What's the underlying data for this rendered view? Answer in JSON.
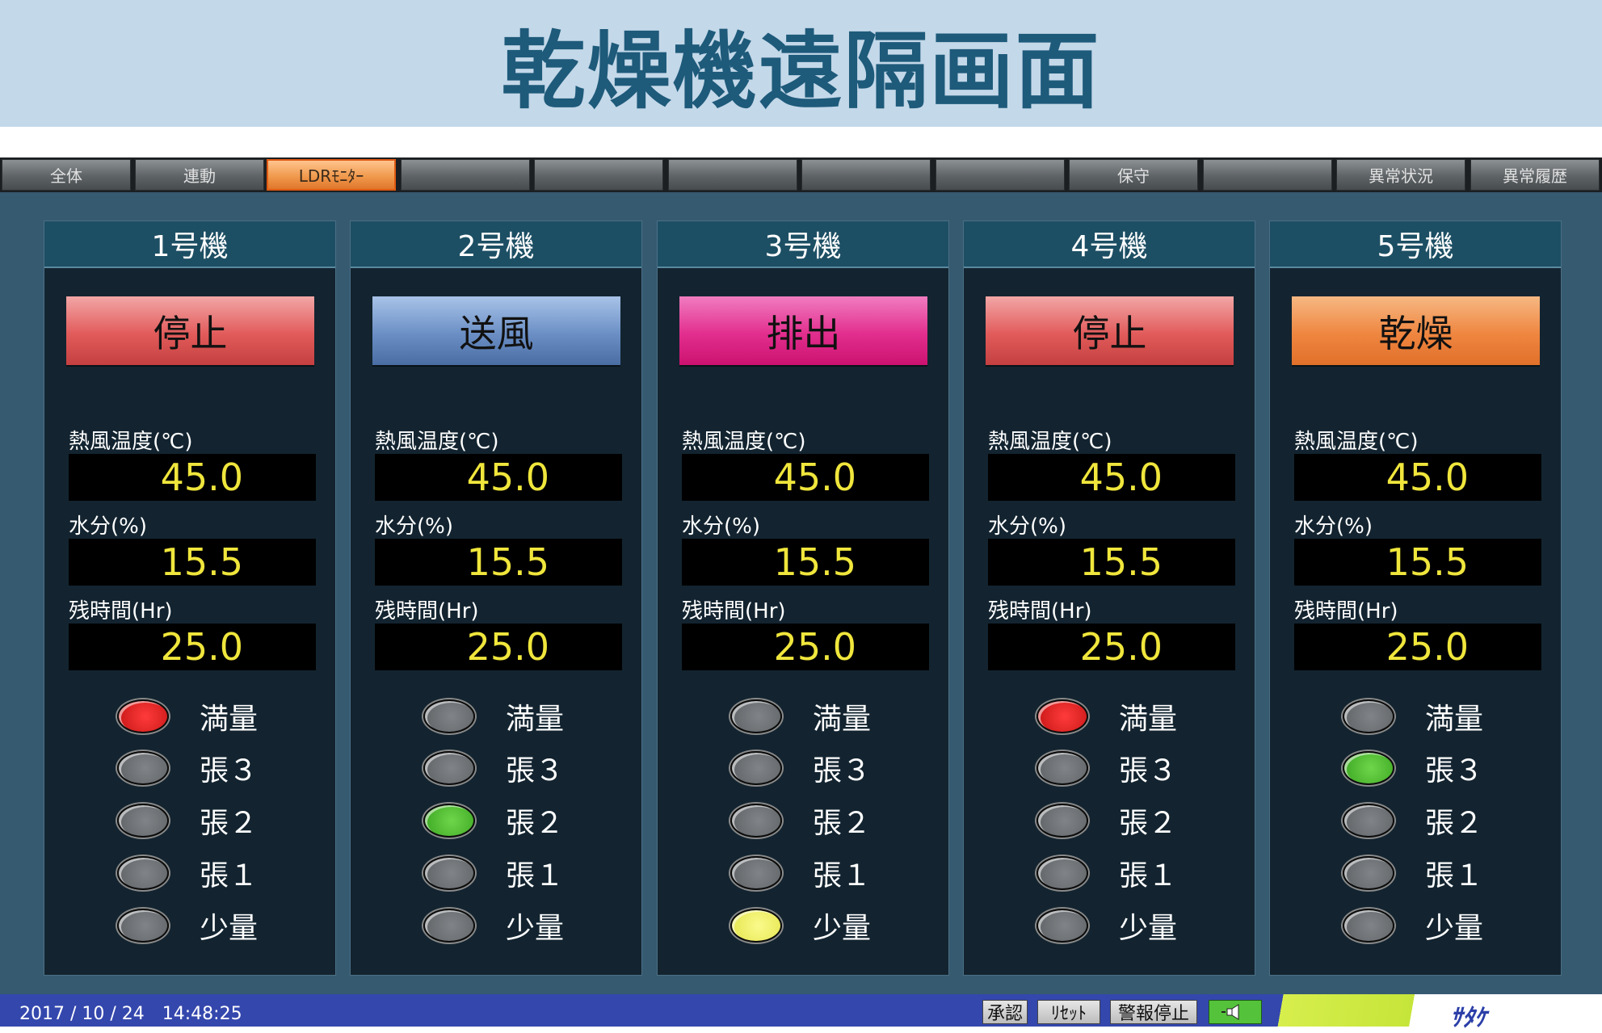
{
  "header": {
    "title": "乾燥機遠隔画面"
  },
  "tabs": [
    {
      "label": "全体"
    },
    {
      "label": "連動"
    },
    {
      "label": "LDRﾓﾆﾀｰ",
      "active": true
    },
    {
      "label": ""
    },
    {
      "label": ""
    },
    {
      "label": ""
    },
    {
      "label": ""
    },
    {
      "label": ""
    },
    {
      "label": "保守"
    },
    {
      "label": ""
    },
    {
      "label": "異常状況"
    },
    {
      "label": "異常履歴"
    }
  ],
  "field_labels": {
    "temp": "熱風温度(℃)",
    "moisture": "水分(%)",
    "remaining": "残時間(Hr)"
  },
  "lamp_labels": [
    "満量",
    "張３",
    "張２",
    "張１",
    "少量"
  ],
  "machines": [
    {
      "name": "1号機",
      "status": "停止",
      "status_color": "#e25b5b",
      "temp": "45.0",
      "moisture": "15.5",
      "remaining": "25.0",
      "lamps": [
        "red",
        "gray",
        "gray",
        "gray",
        "gray"
      ]
    },
    {
      "name": "2号機",
      "status": "送風",
      "status_color": "#6b8fc5",
      "temp": "45.0",
      "moisture": "15.5",
      "remaining": "25.0",
      "lamps": [
        "gray",
        "gray",
        "green",
        "gray",
        "gray"
      ]
    },
    {
      "name": "3号機",
      "status": "排出",
      "status_color": "#e22e8e",
      "temp": "45.0",
      "moisture": "15.5",
      "remaining": "25.0",
      "lamps": [
        "gray",
        "gray",
        "gray",
        "gray",
        "yellow"
      ]
    },
    {
      "name": "4号機",
      "status": "停止",
      "status_color": "#e25b5b",
      "temp": "45.0",
      "moisture": "15.5",
      "remaining": "25.0",
      "lamps": [
        "red",
        "gray",
        "gray",
        "gray",
        "gray"
      ]
    },
    {
      "name": "5号機",
      "status": "乾燥",
      "status_color": "#ef8640",
      "temp": "45.0",
      "moisture": "15.5",
      "remaining": "25.0",
      "lamps": [
        "gray",
        "green",
        "gray",
        "gray",
        "gray"
      ]
    }
  ],
  "footer": {
    "datetime": "2017 / 10 / 24　14:48:25",
    "ack_label": "承認",
    "reset_label": "ﾘｾｯﾄ",
    "alarm_stop_label": "警報停止",
    "speaker_icon": "speaker-icon",
    "logo": "ｻﾀｹ"
  },
  "colors": {
    "accent": "#1e5a7a",
    "panel_bg": "#132430",
    "readout_text": "#f0e63c",
    "status_bar": "#3447ad"
  }
}
